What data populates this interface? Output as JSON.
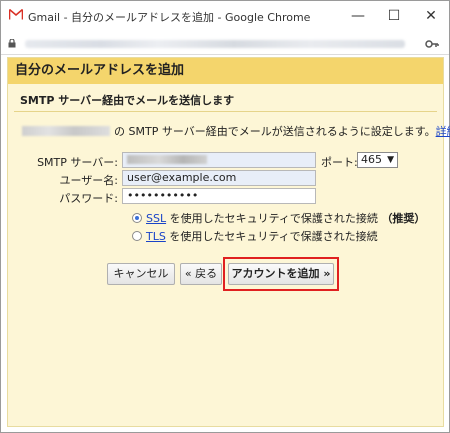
{
  "window": {
    "title": "Gmail - 自分のメールアドレスを追加 - Google Chrome",
    "minimize_glyph": "—",
    "maximize_glyph": "☐",
    "close_glyph": "✕"
  },
  "page": {
    "title": "自分のメールアドレスを追加",
    "section_header": "SMTP サーバー経由でメールを送信します",
    "intro_text": "の SMTP サーバー経由でメールが送信されるように設定します。",
    "intro_link": "詳細"
  },
  "form": {
    "smtp_label": "SMTP サーバー:",
    "username_label": "ユーザー名:",
    "username_value": "user@example.com",
    "password_label": "パスワード:",
    "password_value": "•••••••••••",
    "port_label": "ポート:",
    "port_value": "465",
    "ssl_prefix": "",
    "ssl_link": "SSL",
    "ssl_text": " を使用したセキュリティで保護された接続 ",
    "ssl_recommended": "（推奨）",
    "tls_link": "TLS",
    "tls_text": " を使用したセキュリティで保護された接続"
  },
  "buttons": {
    "cancel": "キャンセル",
    "back": "« 戻る",
    "add": "アカウントを追加 »"
  },
  "colors": {
    "header_bg": "#f4d56c",
    "content_bg": "#fdf6d6",
    "link": "#1a44c8",
    "highlight": "#e02020"
  }
}
